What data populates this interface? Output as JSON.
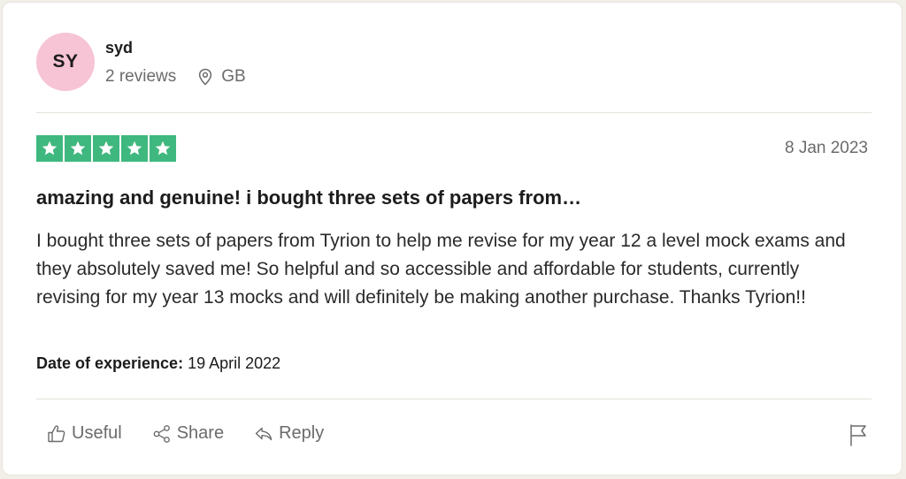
{
  "reviewer": {
    "initials": "SY",
    "name": "syd",
    "reviews_count": "2 reviews",
    "location": "GB",
    "avatar_color": "#f6c4d5"
  },
  "review": {
    "rating": 5,
    "rating_color": "#3fb87f",
    "date": "8 Jan 2023",
    "title": "amazing and genuine! i bought three sets of papers from…",
    "body": "I bought three sets of papers from Tyrion to help me revise for my year 12 a level mock exams and they absolutely saved me! So helpful and so accessible and affordable for students, currently revising for my year 13 mocks and will definitely be making another purchase. Thanks Tyrion!!",
    "experience_label": "Date of experience:",
    "experience_date": "19 April 2022"
  },
  "actions": {
    "useful_label": "Useful",
    "share_label": "Share",
    "reply_label": "Reply"
  },
  "icons": {
    "location": "location-pin-icon",
    "useful": "thumbs-up-icon",
    "share": "share-icon",
    "reply": "reply-icon",
    "flag": "flag-icon",
    "star": "star-icon"
  }
}
